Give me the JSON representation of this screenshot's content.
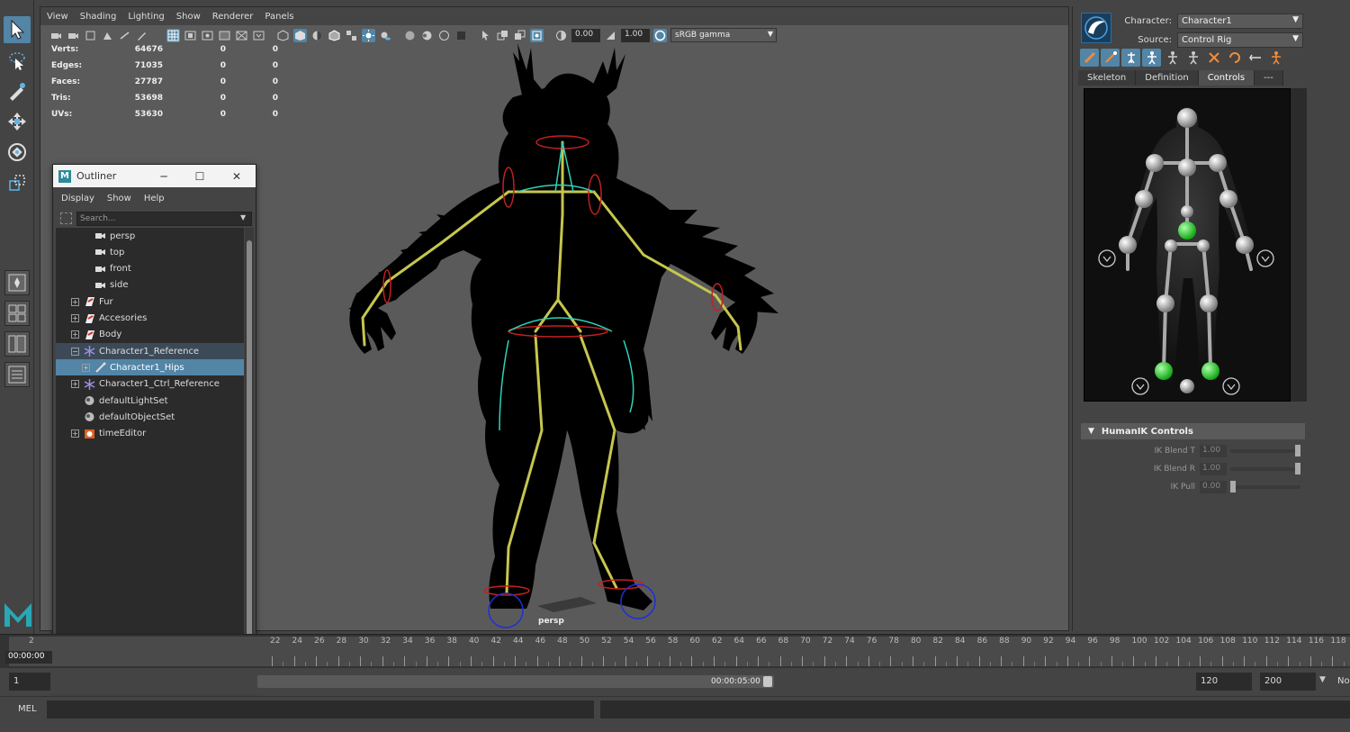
{
  "viewport": {
    "menu": [
      "View",
      "Shading",
      "Lighting",
      "Show",
      "Renderer",
      "Panels"
    ],
    "exposure": "0.00",
    "gamma": "1.00",
    "color_space": "sRGB gamma",
    "camera_label": "persp",
    "hud": [
      {
        "label": "Verts:",
        "total": "64676",
        "selected": "0",
        "components": "0"
      },
      {
        "label": "Edges:",
        "total": "71035",
        "selected": "0",
        "components": "0"
      },
      {
        "label": "Faces:",
        "total": "27787",
        "selected": "0",
        "components": "0"
      },
      {
        "label": "Tris:",
        "total": "53698",
        "selected": "0",
        "components": "0"
      },
      {
        "label": "UVs:",
        "total": "53630",
        "selected": "0",
        "components": "0"
      }
    ]
  },
  "outliner": {
    "title": "Outliner",
    "menu": [
      "Display",
      "Show",
      "Help"
    ],
    "search_placeholder": "Search...",
    "items": [
      {
        "label": "persp",
        "icon": "camera-icon",
        "expandable": false,
        "indent": 1,
        "state": ""
      },
      {
        "label": "top",
        "icon": "camera-icon",
        "expandable": false,
        "indent": 1,
        "state": ""
      },
      {
        "label": "front",
        "icon": "camera-icon",
        "expandable": false,
        "indent": 1,
        "state": ""
      },
      {
        "label": "side",
        "icon": "camera-icon",
        "expandable": false,
        "indent": 1,
        "state": ""
      },
      {
        "label": "Fur",
        "icon": "mesh-layer-icon",
        "expandable": true,
        "indent": 0,
        "state": ""
      },
      {
        "label": "Accesories",
        "icon": "mesh-layer-icon",
        "expandable": true,
        "indent": 0,
        "state": ""
      },
      {
        "label": "Body",
        "icon": "mesh-layer-icon",
        "expandable": true,
        "indent": 0,
        "state": ""
      },
      {
        "label": "Character1_Reference",
        "icon": "joint-icon",
        "expandable": true,
        "indent": 0,
        "state": "hl"
      },
      {
        "label": "Character1_Hips",
        "icon": "bone-icon",
        "expandable": true,
        "indent": 1,
        "state": "sel"
      },
      {
        "label": "Character1_Ctrl_Reference",
        "icon": "joint-icon",
        "expandable": true,
        "indent": 0,
        "state": ""
      },
      {
        "label": "defaultLightSet",
        "icon": "set-icon",
        "expandable": false,
        "indent": 0,
        "state": ""
      },
      {
        "label": "defaultObjectSet",
        "icon": "set-icon",
        "expandable": false,
        "indent": 0,
        "state": ""
      },
      {
        "label": "timeEditor",
        "icon": "time-editor-icon",
        "expandable": true,
        "indent": 0,
        "state": ""
      }
    ]
  },
  "humanik": {
    "character_label": "Character:",
    "character_value": "Character1",
    "source_label": "Source:",
    "source_value": "Control Rig",
    "tabs": [
      "Skeleton",
      "Definition",
      "Controls",
      "---"
    ],
    "active_tab": "Controls",
    "controls_header": "HumanIK Controls",
    "sliders": [
      {
        "label": "IK Blend T",
        "value": "1.00",
        "fraction": 1.0
      },
      {
        "label": "IK Blend R",
        "value": "1.00",
        "fraction": 1.0
      },
      {
        "label": "IK Pull",
        "value": "0.00",
        "fraction": 0.0
      }
    ]
  },
  "timeline": {
    "current_time": "00:00:00",
    "first_tick": "2",
    "ticks": [
      "22",
      "24",
      "26",
      "28",
      "30",
      "32",
      "34",
      "36",
      "38",
      "40",
      "42",
      "44",
      "46",
      "48",
      "50",
      "52",
      "54",
      "56",
      "58",
      "60",
      "62",
      "64",
      "66",
      "68",
      "70",
      "72",
      "74",
      "76",
      "78",
      "80",
      "82",
      "84",
      "86",
      "88",
      "90",
      "92",
      "94",
      "96",
      "98",
      "100",
      "102",
      "104",
      "106",
      "108",
      "110",
      "112",
      "114",
      "116",
      "118",
      "120"
    ]
  },
  "range": {
    "start": "1",
    "slider_time": "00:00:05:00",
    "end": "120",
    "max_end": "200",
    "extra_label": "No"
  },
  "command": {
    "label": "MEL"
  }
}
